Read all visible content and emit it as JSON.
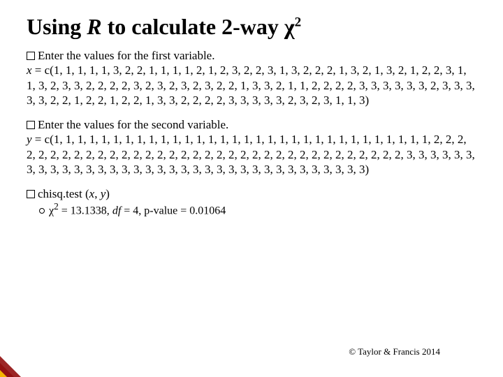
{
  "title_prefix": "Using ",
  "title_R": "R",
  "title_mid": " to calculate 2-way χ",
  "title_sup": "2",
  "block1_lead": "Enter the values for the first variable.",
  "block1_var": "x",
  "block1_eq": " = c(1, 1, 1, 1, 1, 3, 2, 2, 1, 1, 1, 1, 2, 1, 2, 3, 2, 2, 3, 1, 3, 2, 2, 2, 1, 3, 2, 1, 3, 2, 1, 2, 2, 3, 1, 1, 3, 2, 3, 3, 2, 2, 2, 2, 3, 2, 3, 2, 3, 2, 3, 2, 2, 1, 3, 3, 2, 1, 1, 2, 2, 2, 2, 3, 3, 3, 3, 3, 3, 2, 3, 3, 3, 3, 3, 2, 2, 1, 2, 2, 1, 2, 2, 1, 3, 3, 2, 2, 2, 2, 3, 3, 3, 3, 3, 2, 3, 2, 3, 1, 1, 3)",
  "block2_lead": "Enter the values for the second variable.",
  "block2_var": "y",
  "block2_eq": " = c(1, 1, 1, 1, 1, 1, 1, 1, 1, 1, 1, 1, 1, 1, 1, 1, 1, 1, 1, 1, 1, 1, 1, 1, 1, 1, 1, 1, 1, 1, 1, 1, 2, 2, 2, 2, 2, 2, 2, 2, 2, 2, 2, 2, 2, 2, 2, 2, 2, 2, 2, 2, 2, 2, 2, 2, 2, 2, 2, 2, 2, 2, 2, 2, 2, 2, 2, 3, 3, 3, 3, 3, 3, 3, 3, 3, 3, 3, 3, 3, 3, 3, 3, 3, 3, 3, 3, 3, 3, 3, 3, 3, 3, 3, 3, 3, 3, 3, 3, 3, 3, 3)",
  "block3_cmd": "chisq.test (",
  "block3_x": "x",
  "block3_sep": ", ",
  "block3_y": "y",
  "block3_close": ")",
  "result_chi": "χ",
  "result_sup": "2",
  "result_eq": " = 13.1338, ",
  "result_df_lbl": "df",
  "result_df_val": " = 4, p-value = 0.01064",
  "footer": "© Taylor & Francis 2014"
}
